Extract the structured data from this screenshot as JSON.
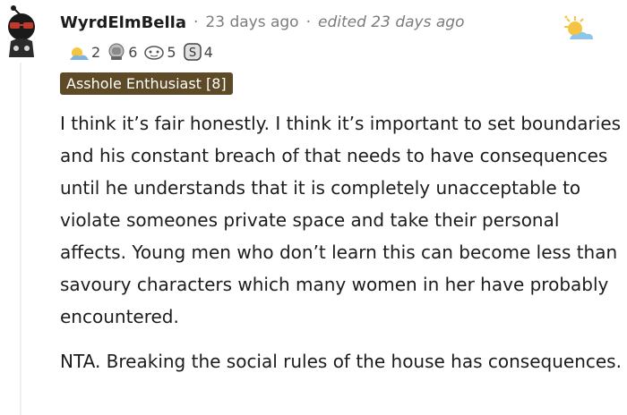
{
  "comment": {
    "username": "WyrdElmBella",
    "separator": "·",
    "timestamp": "23 days ago",
    "edited": "edited 23 days ago",
    "flair": "Asshole Enthusiast [8]",
    "awards": [
      {
        "icon": "rising-sun-award-icon",
        "count": "2"
      },
      {
        "icon": "facepalm-award-icon",
        "count": "6"
      },
      {
        "icon": "snoo-award-icon",
        "count": "5"
      },
      {
        "icon": "silver-coin-award-icon",
        "count": "4"
      }
    ],
    "paragraphs": [
      "I think it’s fair honestly. I think it’s important to set boundaries and his constant breach of that needs to have consequences until he understands that it is completely unacceptable to violate someones private space and take their personal affects. Young men who don’t learn this can become less than savoury characters which many women in her have probably encountered.",
      "NTA. Breaking the social rules of the house has consequences."
    ]
  },
  "colors": {
    "flair_bg": "#5e4a27",
    "meta_text": "#7c7c7c",
    "body_text": "#1c1c1c"
  }
}
